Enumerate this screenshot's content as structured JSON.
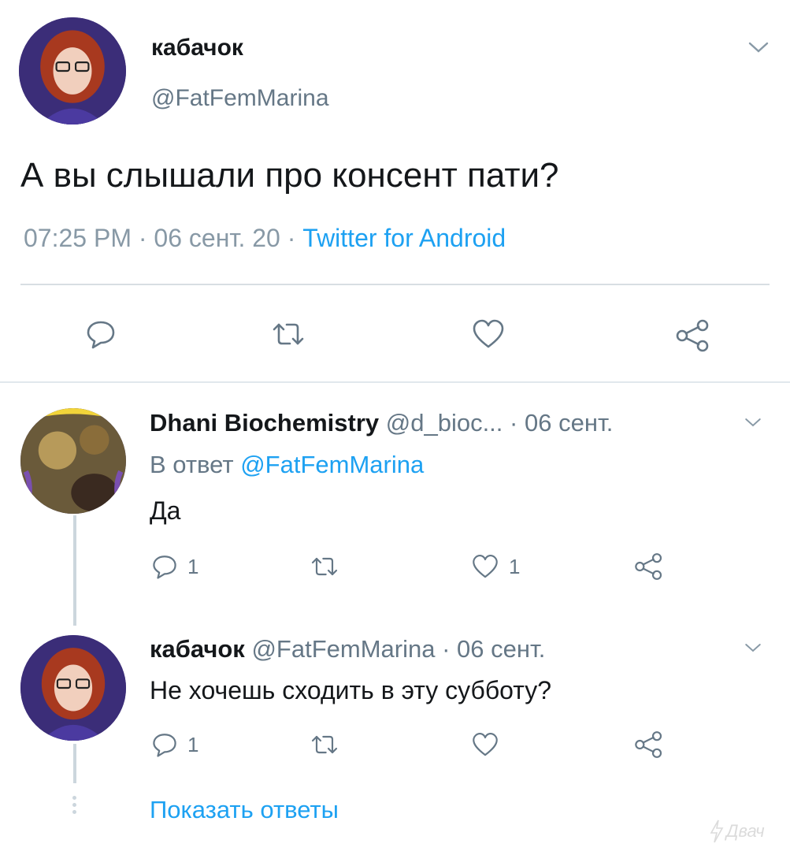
{
  "main_tweet": {
    "display_name": "кабачок",
    "handle": "@FatFemMarina",
    "text": "А вы слышали про консент пати?",
    "time": "07:25 PM",
    "sep1": "·",
    "date": "06 сент. 20",
    "sep2": "·",
    "source": "Twitter for Android"
  },
  "reply1": {
    "display_name": "Dhani Biochemistry",
    "handle": "@d_bioc...",
    "sep": "·",
    "date": "06 сент.",
    "reply_to_label": "В ответ",
    "reply_to_handle": "@FatFemMarina",
    "text": "Да",
    "reply_count": "1",
    "like_count": "1"
  },
  "reply2": {
    "display_name": "кабачок",
    "handle": "@FatFemMarina",
    "sep": "·",
    "date": "06 сент.",
    "text": "Не хочешь сходить в эту субботу?",
    "reply_count": "1"
  },
  "show_replies": "Показать ответы",
  "watermark": "Двач",
  "colors": {
    "link": "#1da1f2",
    "text": "#14171a",
    "secondary": "#657786"
  }
}
